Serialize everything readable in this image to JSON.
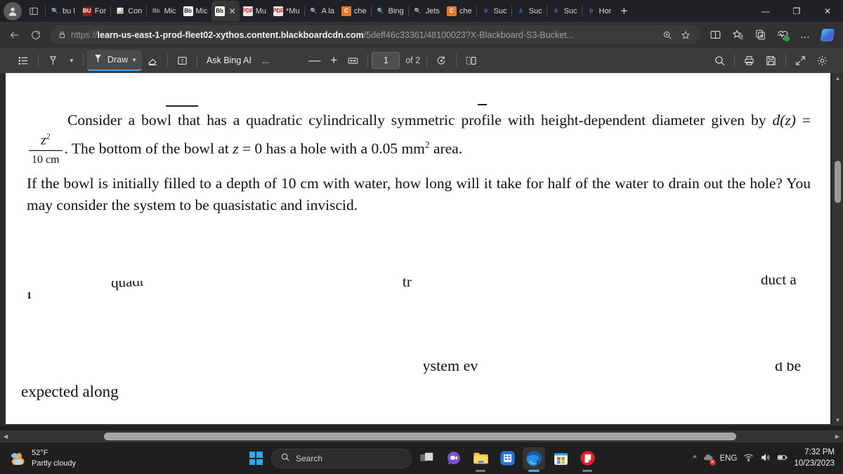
{
  "browser": {
    "tabs": [
      {
        "label": "bu l",
        "icon": "search-icon",
        "icon_kind": "fav-search",
        "active": false
      },
      {
        "label": "For",
        "icon": "bu-logo-icon",
        "icon_kind": "fav-bu",
        "active": false
      },
      {
        "label": "Con",
        "icon": "chart-icon",
        "icon_kind": "fav-chart",
        "active": false
      },
      {
        "label": "Mic",
        "icon": "blackboard-icon",
        "icon_kind": "fav-bb-g",
        "active": false
      },
      {
        "label": "Mic",
        "icon": "blackboard-icon",
        "icon_kind": "fav-bb-w",
        "active": false
      },
      {
        "label": "",
        "icon": "blackboard-icon",
        "icon_kind": "fav-bb-w",
        "active": true
      },
      {
        "label": "Mu",
        "icon": "pdf-icon",
        "icon_kind": "fav-pdf",
        "active": false
      },
      {
        "label": "*Mu",
        "icon": "pdf-icon",
        "icon_kind": "fav-pdf",
        "active": false
      },
      {
        "label": "A la",
        "icon": "search-icon",
        "icon_kind": "fav-search",
        "active": false
      },
      {
        "label": "che",
        "icon": "chegg-icon",
        "icon_kind": "fav-c",
        "active": false
      },
      {
        "label": "Bing",
        "icon": "search-icon",
        "icon_kind": "fav-search",
        "active": false
      },
      {
        "label": "Jets",
        "icon": "search-icon",
        "icon_kind": "fav-search",
        "active": false
      },
      {
        "label": "che",
        "icon": "chegg-icon",
        "icon_kind": "fav-c",
        "active": false
      },
      {
        "label": "Suc",
        "icon": "bartleby-icon",
        "icon_kind": "fav-b",
        "active": false
      },
      {
        "label": "Suc",
        "icon": "bartleby-icon",
        "icon_kind": "fav-b",
        "active": false
      },
      {
        "label": "Suc",
        "icon": "bartleby-icon",
        "icon_kind": "fav-b",
        "active": false
      },
      {
        "label": "Hor",
        "icon": "bartleby-icon",
        "icon_kind": "fav-b",
        "active": false
      }
    ],
    "new_tab_label": "+",
    "close_tab_label": "✕",
    "window_controls": {
      "minimize": "—",
      "maximize": "❐",
      "close": "✕"
    },
    "url": {
      "scheme": "https://",
      "host": "learn-us-east-1-prod-fleet02-xythos.content.blackboardcdn.com",
      "path": "/5deff46c33361/48100023?X-Blackboard-S3-Bucket..."
    }
  },
  "pdf_toolbar": {
    "toc_label": "table-of-contents",
    "highlighter_label": "highlighter",
    "draw_label": "Draw",
    "erase_label": "erase",
    "text_label": "text",
    "ask_bing_label": "Ask Bing AI",
    "more_label": "...",
    "zoom_out_label": "—",
    "zoom_in_label": "+",
    "fit_label": "fit-to-width",
    "page_current": "1",
    "page_total": "of 2",
    "rotate_label": "rotate",
    "layout_label": "page-layout",
    "search_label": "search",
    "print_label": "print",
    "save_label": "save",
    "fullscreen_label": "fullscreen",
    "settings_label": "settings"
  },
  "document": {
    "paragraph_1_a": "Consider a bowl that has a quadratic cylindrically symmetric profile with height-dependent diameter given by ",
    "math_d": "d",
    "math_paren_open": "(",
    "math_z": "z",
    "math_paren_close": ")",
    "math_equals": " = ",
    "frac_num": "z",
    "frac_num_sup": "2",
    "frac_den": "10 cm",
    "paragraph_1_b": ". The bottom of the bowl at ",
    "math_z2": "z",
    "math_equals2": " = ",
    "math_zero": "0",
    "paragraph_1_c": " has a hole with a 0.05 mm",
    "paragraph_1_c_sup": "2",
    "paragraph_1_d": " area.",
    "paragraph_2": "If the bowl is initially filled to a depth of 10 cm with water, how long will it take for half of the water to drain out the hole? You may consider the system to be quasistatic and inviscid.",
    "fragment_1": "1",
    "fragment_2": "quadr",
    "fragment_3": "tr",
    "fragment_4": "duct a",
    "fragment_5": "system ev",
    "fragment_6": "d be",
    "fragment_7": "expected along"
  },
  "taskbar": {
    "weather_temp": "52°F",
    "weather_desc": "Partly cloudy",
    "start_label": "start",
    "search_placeholder": "Search",
    "task_view_label": "task-view",
    "teams_label": "teams",
    "file_explorer_label": "file-explorer",
    "calculator_label": "calculator",
    "edge_label": "microsoft-edge",
    "store_label": "microsoft-store",
    "sticky_label": "sticky-notes",
    "tray_expand_label": "^",
    "language_label": "ENG",
    "time": "7:32 PM",
    "date": "10/23/2023"
  },
  "colors": {
    "tabstrip_bg": "#202124",
    "navbar_bg": "#323232",
    "pdfbar_bg": "#3b3b3b",
    "viewport_bg": "#2b2b2b",
    "page_bg": "#ffffff",
    "taskbar_bg": "#1f1f1f",
    "accent_blue": "#4aa3e0"
  }
}
